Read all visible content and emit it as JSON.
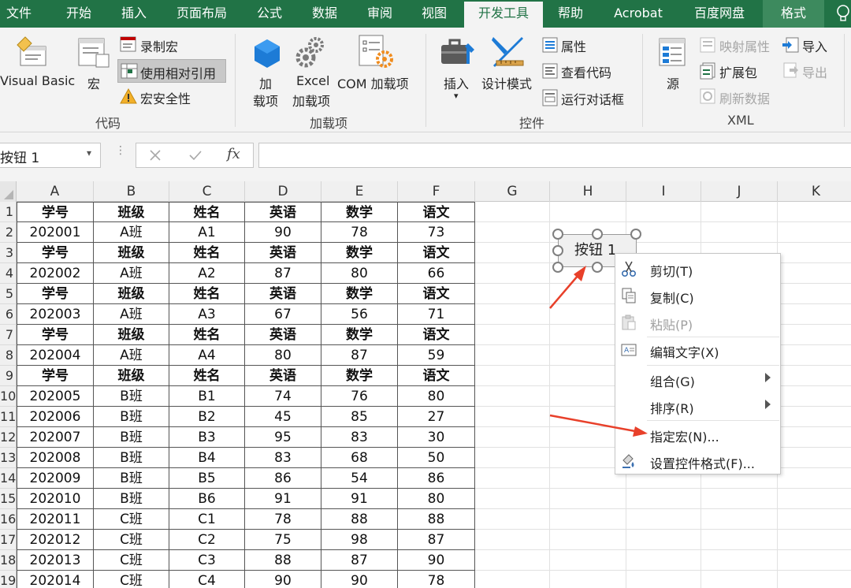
{
  "tabs": [
    {
      "id": "file",
      "label": "文件"
    },
    {
      "id": "home",
      "label": "开始"
    },
    {
      "id": "insert",
      "label": "插入"
    },
    {
      "id": "layout",
      "label": "页面布局"
    },
    {
      "id": "formulas",
      "label": "公式"
    },
    {
      "id": "data",
      "label": "数据"
    },
    {
      "id": "review",
      "label": "审阅"
    },
    {
      "id": "view",
      "label": "视图"
    },
    {
      "id": "developer",
      "label": "开发工具"
    },
    {
      "id": "help",
      "label": "帮助"
    },
    {
      "id": "acrobat",
      "label": "Acrobat"
    },
    {
      "id": "baidu",
      "label": "百度网盘"
    },
    {
      "id": "format",
      "label": "格式"
    }
  ],
  "ribbon": {
    "code": {
      "title": "代码",
      "visual_basic": "Visual Basic",
      "macros": "宏",
      "record_macro": "录制宏",
      "relative_ref": "使用相对引用",
      "macro_security": "宏安全性"
    },
    "addins": {
      "title": "加载项",
      "addins_l1": "加",
      "addins_l2": "载项",
      "excel_l1": "Excel",
      "excel_l2": "加载项",
      "com": "COM 加载项"
    },
    "controls": {
      "title": "控件",
      "insert": "插入",
      "design_mode": "设计模式",
      "properties": "属性",
      "view_code": "查看代码",
      "run_dialog": "运行对话框"
    },
    "xml": {
      "title": "XML",
      "source": "源",
      "map_props": "映射属性",
      "expansion": "扩展包",
      "refresh": "刷新数据",
      "import": "导入",
      "export": "导出"
    }
  },
  "formula_bar": {
    "name_box": "按钮 1",
    "fx": "fx",
    "value": ""
  },
  "columns": [
    "A",
    "B",
    "C",
    "D",
    "E",
    "F",
    "G",
    "H",
    "I",
    "J",
    "K"
  ],
  "rows": [
    {
      "num": "1",
      "cells": [
        "学号",
        "班级",
        "姓名",
        "英语",
        "数学",
        "语文"
      ],
      "header": true
    },
    {
      "num": "2",
      "cells": [
        "202001",
        "A班",
        "A1",
        "90",
        "78",
        "73"
      ]
    },
    {
      "num": "3",
      "cells": [
        "学号",
        "班级",
        "姓名",
        "英语",
        "数学",
        "语文"
      ],
      "header": true
    },
    {
      "num": "4",
      "cells": [
        "202002",
        "A班",
        "A2",
        "87",
        "80",
        "66"
      ]
    },
    {
      "num": "5",
      "cells": [
        "学号",
        "班级",
        "姓名",
        "英语",
        "数学",
        "语文"
      ],
      "header": true
    },
    {
      "num": "6",
      "cells": [
        "202003",
        "A班",
        "A3",
        "67",
        "56",
        "71"
      ]
    },
    {
      "num": "7",
      "cells": [
        "学号",
        "班级",
        "姓名",
        "英语",
        "数学",
        "语文"
      ],
      "header": true
    },
    {
      "num": "8",
      "cells": [
        "202004",
        "A班",
        "A4",
        "80",
        "87",
        "59"
      ]
    },
    {
      "num": "9",
      "cells": [
        "学号",
        "班级",
        "姓名",
        "英语",
        "数学",
        "语文"
      ],
      "header": true
    },
    {
      "num": "10",
      "cells": [
        "202005",
        "B班",
        "B1",
        "74",
        "76",
        "80"
      ]
    },
    {
      "num": "11",
      "cells": [
        "202006",
        "B班",
        "B2",
        "45",
        "85",
        "27"
      ]
    },
    {
      "num": "12",
      "cells": [
        "202007",
        "B班",
        "B3",
        "95",
        "83",
        "30"
      ]
    },
    {
      "num": "13",
      "cells": [
        "202008",
        "B班",
        "B4",
        "83",
        "68",
        "50"
      ]
    },
    {
      "num": "14",
      "cells": [
        "202009",
        "B班",
        "B5",
        "86",
        "54",
        "86"
      ]
    },
    {
      "num": "15",
      "cells": [
        "202010",
        "B班",
        "B6",
        "91",
        "91",
        "80"
      ]
    },
    {
      "num": "16",
      "cells": [
        "202011",
        "C班",
        "C1",
        "78",
        "88",
        "88"
      ]
    },
    {
      "num": "17",
      "cells": [
        "202012",
        "C班",
        "C2",
        "75",
        "98",
        "87"
      ]
    },
    {
      "num": "18",
      "cells": [
        "202013",
        "C班",
        "C3",
        "88",
        "87",
        "90"
      ]
    },
    {
      "num": "19",
      "cells": [
        "202014",
        "C班",
        "C4",
        "90",
        "90",
        "78"
      ]
    }
  ],
  "form_button": {
    "label": "按钮 1"
  },
  "context_menu": [
    {
      "id": "cut",
      "label": "剪切(T)",
      "icon": "scissors-icon"
    },
    {
      "id": "copy",
      "label": "复制(C)",
      "icon": "copy-icon"
    },
    {
      "id": "paste",
      "label": "粘贴(P)",
      "icon": "paste-icon",
      "disabled": true
    },
    {
      "id": "edit-text",
      "label": "编辑文字(X)",
      "icon": "edit-text-icon"
    },
    {
      "id": "group",
      "label": "组合(G)",
      "submenu": true
    },
    {
      "id": "order",
      "label": "排序(R)",
      "submenu": true
    },
    {
      "id": "assign-macro",
      "label": "指定宏(N)..."
    },
    {
      "id": "format-control",
      "label": "设置控件格式(F)...",
      "icon": "format-control-icon"
    }
  ],
  "colors": {
    "ribbon_green": "#217346",
    "annotation_arrow": "#e8402a"
  }
}
